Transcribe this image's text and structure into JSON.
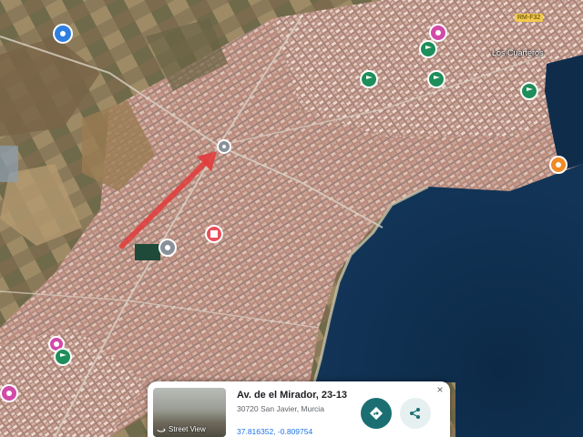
{
  "map": {
    "place_labels": {
      "town": "Los Cuarteros"
    },
    "road_badges": {
      "top_red": "",
      "top_right": "RM-F32"
    },
    "top_chip": {
      "label": ""
    },
    "markers": [
      {
        "kind": "pin-blue",
        "icon": "pin-icon",
        "color": "#2f7fe0"
      },
      {
        "kind": "pin-magenta",
        "icon": "pin-icon",
        "color": "#d24aa8"
      },
      {
        "kind": "pin-green",
        "icon": "park-icon",
        "color": "#1e8e5a"
      },
      {
        "kind": "pin-orange",
        "icon": "pin-icon",
        "color": "#f08a24"
      },
      {
        "kind": "pin-red",
        "icon": "pin-icon",
        "color": "#e8505b"
      },
      {
        "kind": "pin-grey",
        "icon": "pin-icon",
        "color": "#8a9099"
      }
    ],
    "route_arrow_color": "#e23b3b"
  },
  "place_card": {
    "title": "Av. de el Mirador, 23-13",
    "address": "30720 San Javier, Murcia",
    "coordinates": "37.816352, -0.809754",
    "street_view_label": "Street View",
    "close_symbol": "×",
    "directions_icon": "directions-icon",
    "share_icon": "share-icon",
    "accent_color": "#1b6f72"
  }
}
